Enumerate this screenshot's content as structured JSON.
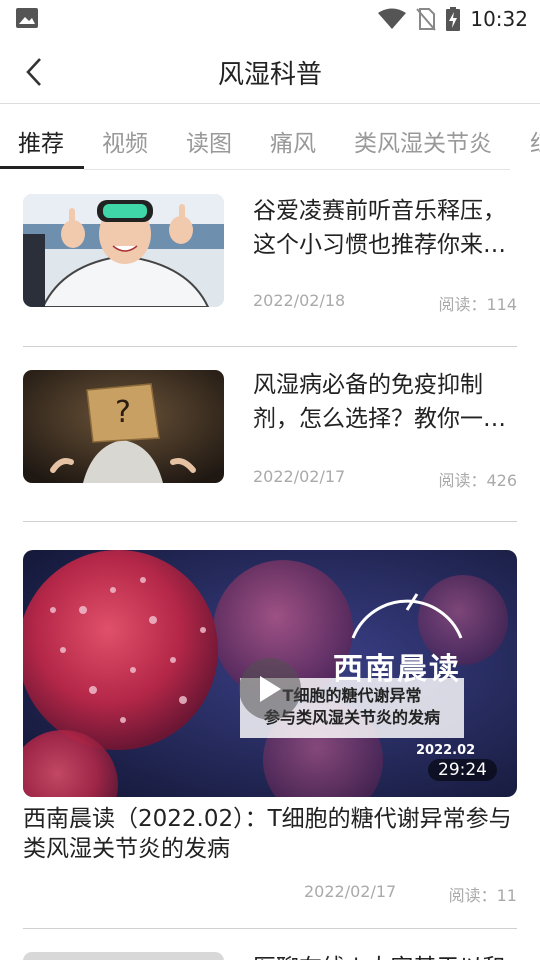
{
  "status_bar": {
    "time": "10:32"
  },
  "header": {
    "title": "风湿科普"
  },
  "tabs": [
    {
      "label": "推荐",
      "active": true
    },
    {
      "label": "视频",
      "active": false
    },
    {
      "label": "读图",
      "active": false
    },
    {
      "label": "痛风",
      "active": false
    },
    {
      "label": "类风湿关节炎",
      "active": false
    },
    {
      "label": "红",
      "active": false
    }
  ],
  "articles": [
    {
      "title": "谷爱凌赛前听音乐释压，这个小习惯也推荐你来…",
      "date": "2022/02/18",
      "reads": "阅读：114"
    },
    {
      "title": "风湿病必备的免疫抑制剂，怎么选择？教你一…",
      "date": "2022/02/17",
      "reads": "阅读：426"
    }
  ],
  "video": {
    "heading": "西南晨读",
    "caption": "T细胞的糖代谢异常\n参与类风湿关节炎的发病",
    "thumb_date": "2022.02",
    "duration": "29:24",
    "title": "西南晨读（2022.02）：T细胞的糖代谢异常参与类风湿关节炎的发病",
    "date": "2022/02/17",
    "reads": "阅读：11"
  },
  "partial_item": {
    "title": "医聊在线 | 大家基于以和"
  },
  "colors": {
    "active_tab": "#222222",
    "inactive_tab": "#999999",
    "meta": "#aaaaaa"
  }
}
